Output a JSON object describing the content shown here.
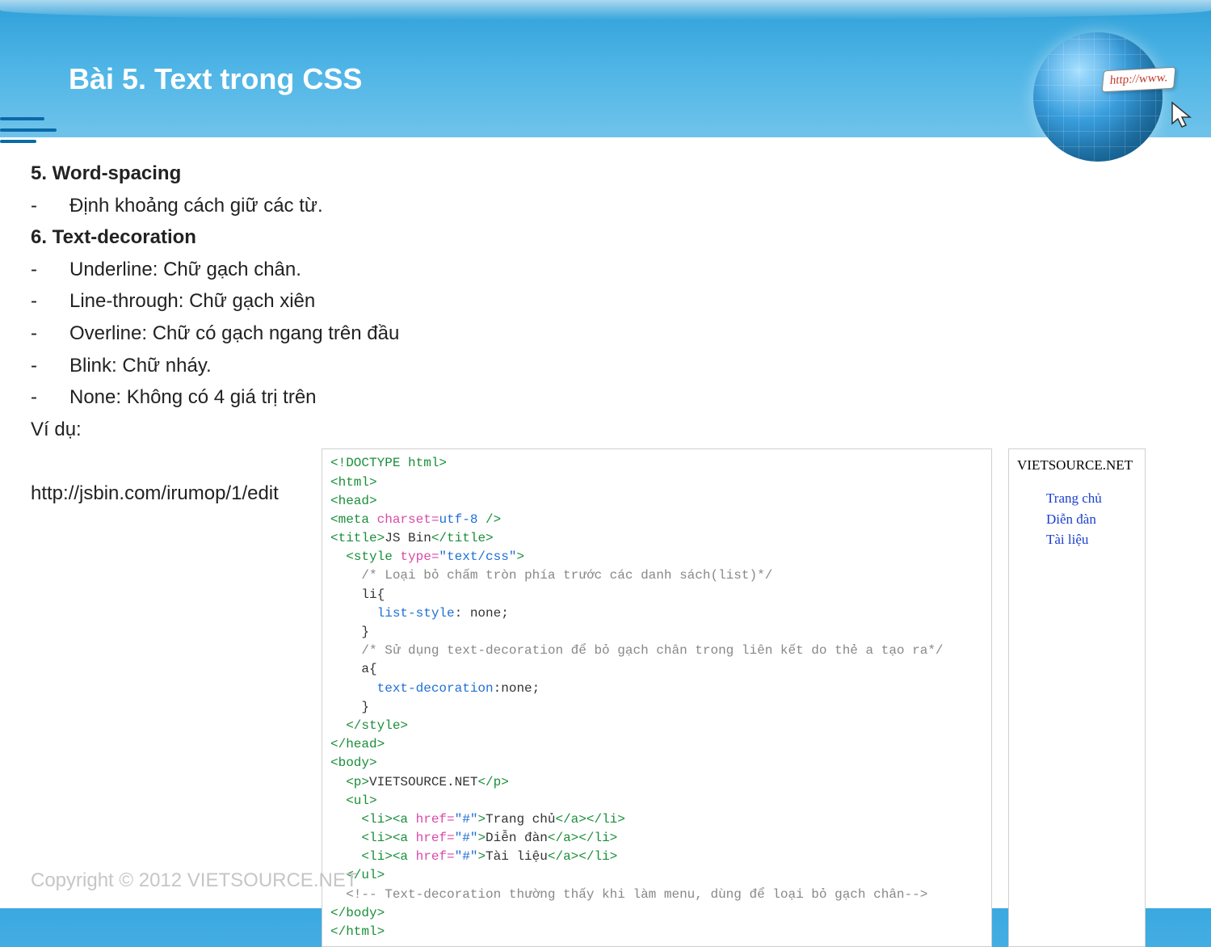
{
  "title": "Bài 5. Text trong CSS",
  "sec5": {
    "heading": "5. Word-spacing",
    "item1": "Định khoảng cách giữ các từ."
  },
  "sec6": {
    "heading": "6. Text-decoration",
    "item1": "Underline: Chữ gạch chân.",
    "item2": "Line-through: Chữ gạch xiên",
    "item3": "Overline: Chữ có gạch ngang trên đầu",
    "item4": "Blink: Chữ nháy.",
    "item5": "None: Không có 4 giá trị trên"
  },
  "example_label": "Ví dụ:",
  "example_url": "http://jsbin.com/irumop/1/edit",
  "code": {
    "l1a": "<!DOCTYPE html>",
    "l2a": "<html>",
    "l3a": "<head>",
    "l4a": "<meta",
    "l4b": " charset=",
    "l4c": "utf-8",
    "l4d": " />",
    "l5a": "<title>",
    "l5b": "JS Bin",
    "l5c": "</title>",
    "l6a": "  <style",
    "l6b": " type=",
    "l6c": "\"text/css\"",
    "l6d": ">",
    "l7": "    /* Loại bỏ chấm tròn phía trước các danh sách(list)*/",
    "l8": "    li{",
    "l9a": "      list-style",
    "l9b": ": none;",
    "l10": "    }",
    "l11": "    /* Sử dụng text-decoration để bỏ gạch chân trong liên kết do thẻ a tạo ra*/",
    "l12": "    a{",
    "l13a": "      text-decoration",
    "l13b": ":none;",
    "l14": "    }",
    "l15": "  </style>",
    "l16": "</head>",
    "l17": "<body>",
    "l18a": "  <p>",
    "l18b": "VIETSOURCE.NET",
    "l18c": "</p>",
    "l19": "  <ul>",
    "l20a": "    <li><a",
    "l20b": " href=",
    "l20c": "\"#\"",
    "l20d": ">",
    "l20e": "Trang chủ",
    "l20f": "</a></li>",
    "l21a": "    <li><a",
    "l21b": " href=",
    "l21c": "\"#\"",
    "l21d": ">",
    "l21e": "Diễn đàn",
    "l21f": "</a></li>",
    "l22a": "    <li><a",
    "l22b": " href=",
    "l22c": "\"#\"",
    "l22d": ">",
    "l22e": "Tài liệu",
    "l22f": "</a></li>",
    "l23": "  </ul>",
    "l24a": "  ",
    "l24b": "<!-- Text-decoration thường thấy khi làm menu, dùng để loại bỏ gạch chân-->",
    "l25": "</body>",
    "l26": "</html>"
  },
  "preview": {
    "site": "VIETSOURCE.NET",
    "links": [
      "Trang chủ",
      "Diễn đàn",
      "Tài liệu"
    ]
  },
  "www_label": "http://www.",
  "footer": "Copyright © 2012 VIETSOURCE.NET"
}
